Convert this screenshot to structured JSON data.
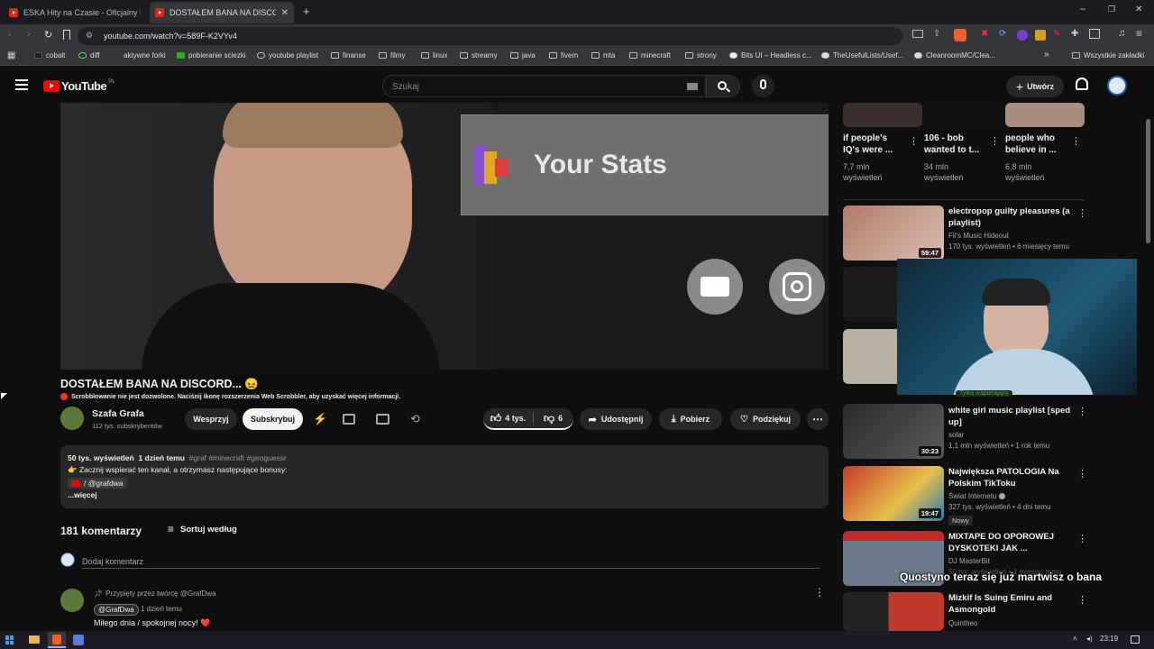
{
  "browser": {
    "tabs": [
      {
        "title": "ESKA Hity na Czasie - Oficjalny Mix G",
        "active": false
      },
      {
        "title": "DOSTAŁEM BANA NA DISCORD...",
        "active": true
      }
    ],
    "new_tab": "+",
    "url": "youtube.com/watch?v=589F-K2VYv4",
    "bookmarks": [
      "cobalt",
      "diff",
      "aktywne forki",
      "pobieranie sciezki",
      "youtube playlist",
      "finanse",
      "filmy",
      "linux",
      "streamy",
      "java",
      "fivem",
      "mta",
      "minecraft",
      "strony",
      "Bits UI – Headless c...",
      "TheUsefulLists/Usef...",
      "CleanroomMC/Clea..."
    ],
    "bookmarks_overflow": "»",
    "all_bookmarks": "Wszystkie zakładki"
  },
  "youtube": {
    "logo": "YouTube",
    "region": "PL",
    "search_placeholder": "Szukaj",
    "create_label": "Utwórz"
  },
  "player": {
    "overlay_title": "Your Stats"
  },
  "video": {
    "title": "DOSTAŁEM BANA NA DISCORD... 😖",
    "scrobble_notice": "Scrobblowanie nie jest dozwolone. Naciśnij ikonę rozszerzenia Web Scrobbler, aby uzyskać więcej informacji.",
    "channel_name": "Szafa Grafa",
    "subscribers": "112 tys. subskrybentów",
    "support_label": "Wesprzyj",
    "subscribe_label": "Subskrybuj",
    "likes": "4 tys.",
    "dislikes": "6",
    "share_label": "Udostępnij",
    "download_label": "Pobierz",
    "thanks_label": "Podziękuj",
    "views": "50 tys. wyświetleń",
    "date": "1 dzień temu",
    "tags": "#graf #minecraft #geoguessr",
    "desc_line1": "👉 Zacznij wspierać ten kanał, a otrzymasz następujące bonusy:",
    "desc_link": "/ @grafdwa",
    "more_label": "...więcej"
  },
  "comments": {
    "count_label": "181 komentarzy",
    "sort_label": "Sortuj według",
    "add_placeholder": "Dodaj komentarz",
    "pinned_label": "Przypięty przez twórcę @GrafDwa",
    "author": "@GrafDwa",
    "time": "1 dzień temu",
    "text": "Miłego dnia / spokojnej nocy! ❤️"
  },
  "recommendations_top": [
    {
      "title": "if people's IQ's were ...",
      "views": "7,7 mln",
      "views2": "wyświetleń"
    },
    {
      "title": "106 - bob wanted to t...",
      "views": "34 mln",
      "views2": "wyświetleń"
    },
    {
      "title": "people who believe in ...",
      "views": "6,8 mln",
      "views2": "wyświetleń"
    }
  ],
  "recommendations": [
    {
      "title": "electropop guilty pleasures (a playlist)",
      "channel": "Fil's Music Hideout",
      "meta": "170 tys. wyświetleń • 6 miesięcy temu",
      "duration": "59:47"
    },
    {
      "title": "white girl music playlist [sped up]",
      "channel": "solar",
      "meta": "1,1 mln wyświetleń • 1 rok temu",
      "duration": "30:23"
    },
    {
      "title": "Największa PATOLOGIA Na Polskim TikToku",
      "channel": "Świat Internetu",
      "meta": "327 tys. wyświetleń • 4 dni temu",
      "duration": "19:47",
      "badge": "Nowy"
    },
    {
      "title": "MIXTAPE DO OPOROWEJ DYSKOTEKI JAK ...",
      "channel": "DJ MasterBit",
      "meta": "50 tys. wyświetleń • 1 miesiąc temu",
      "duration": ""
    },
    {
      "title": "Mizkif Is Suing Emiru and Asmongold",
      "channel": "Quintheo",
      "meta": "",
      "duration": ""
    }
  ],
  "stream_overlay": {
    "caption": "Quostyno teraz się już martwisz o bana",
    "member_label": "Tylko wspierający"
  },
  "taskbar": {
    "clock": "23:19"
  },
  "colors": {
    "youtube_red": "#ff0000",
    "background": "#0f0f0f",
    "surface": "#272727"
  }
}
